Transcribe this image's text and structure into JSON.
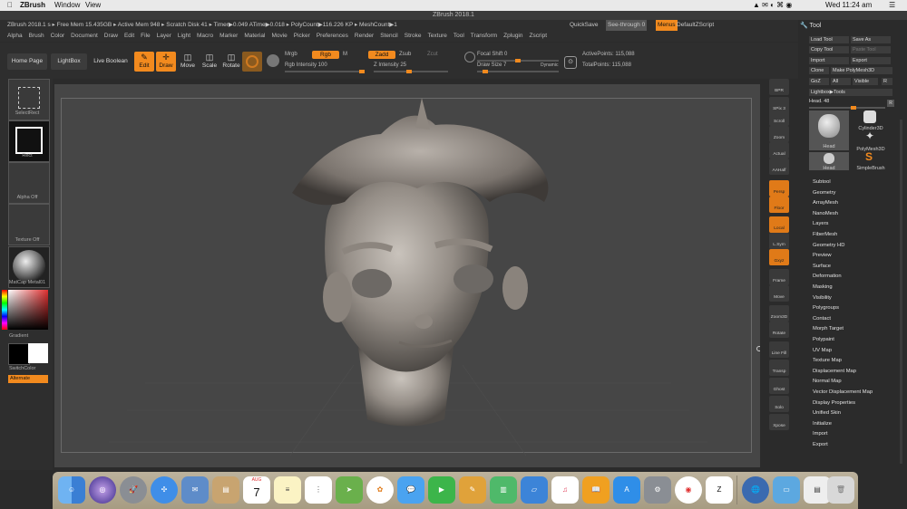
{
  "mac_menubar": {
    "app": "ZBrush",
    "menu_window": "Window",
    "menu_view": "View",
    "clock": "Wed 11:24 am"
  },
  "window_title": "ZBrush 2018.1",
  "infobar": {
    "text": "ZBrush 2018.1 s  ▸ Free Mem 15.435GB ▸ Active Mem 948 ▸ Scratch Disk 41 ▸ Timer▶0.049 ATime▶0.018 ▸ PolyCount▶116.226 KP ▸ MeshCount▶1",
    "quicksave": "QuickSave",
    "see_through": "See-through  0",
    "menus": "Menus",
    "default_zscript": "DefaultZScript"
  },
  "menus": [
    "Alpha",
    "Brush",
    "Color",
    "Document",
    "Draw",
    "Edit",
    "File",
    "Layer",
    "Light",
    "Macro",
    "Marker",
    "Material",
    "Movie",
    "Picker",
    "Preferences",
    "Render",
    "Stencil",
    "Stroke",
    "Texture",
    "Tool",
    "Transform",
    "Zplugin",
    "Zscript"
  ],
  "toolbar": {
    "home_page": "Home Page",
    "lightbox": "LightBox",
    "live_boolean": "Live Boolean",
    "edit": "Edit",
    "draw": "Draw",
    "move": "Move",
    "scale": "Scale",
    "rotate": "Rotate",
    "mrgb": "Mrgb",
    "rgb": "Rgb",
    "m": "M",
    "rgb_intensity": "Rgb Intensity 100",
    "zadd": "Zadd",
    "zsub": "Zsub",
    "zcut": "Zcut",
    "z_intensity": "Z Intensity 25",
    "focal_shift": "Focal Shift 0",
    "draw_size": "Draw Size 7",
    "dynamic": "Dynamic",
    "active_points": "ActivePoints: 115,088",
    "total_points": "TotalPoints: 115,088"
  },
  "left_panel": {
    "select_rect": "SelectRect",
    "rect": "Rect",
    "alpha_off": "Alpha Off",
    "texture_off": "Texture Off",
    "matcap": "MatCap Metal01",
    "gradient": "Gradient",
    "switch_color": "SwitchColor",
    "alternate": "Alternate"
  },
  "right_shelf": [
    "BPR",
    "SPix 3",
    "Scroll",
    "Zoom",
    "Actual",
    "AAHalf",
    "Persp",
    "Floor",
    "Local",
    "L.Sym",
    "Gxyz",
    "Frame",
    "Move",
    "Zoom3D",
    "Rotate",
    "Line Fill PolyF",
    "Transp",
    "Ghost",
    "Solo",
    "Xpose"
  ],
  "tool_panel": {
    "title": "Tool",
    "load_tool": "Load Tool",
    "save_as": "Save As",
    "copy_tool": "Copy Tool",
    "paste_tool": "Paste Tool",
    "import": "Import",
    "export": "Export",
    "clone": "Clone",
    "make_polymesh": "Make PolyMesh3D",
    "goz": "GoZ",
    "all": "All",
    "visible": "Visible",
    "r": "R",
    "lightbox_tools": "Lightbox▶Tools",
    "head_slider": "Head. 48",
    "thumb_head": "Head",
    "thumb_cylinder": "Cylinder3D",
    "thumb_polymesh": "PolyMesh3D",
    "thumb_head2": "Head",
    "thumb_simplebrush": "SimpleBrush",
    "subpalettes": [
      "Subtool",
      "Geometry",
      "ArrayMesh",
      "NanoMesh",
      "Layers",
      "FiberMesh",
      "Geometry HD",
      "Preview",
      "Surface",
      "Deformation",
      "Masking",
      "Visibility",
      "Polygroups",
      "Contact",
      "Morph Target",
      "Polypaint",
      "UV Map",
      "Texture Map",
      "Displacement Map",
      "Normal Map",
      "Vector Displacement Map",
      "Display Properties",
      "Unified Skin",
      "Initialize",
      "Import",
      "Export"
    ]
  },
  "dock": {
    "calendar_month": "AUG",
    "calendar_day": "7"
  },
  "colors": {
    "accent": "#f28a1e",
    "panel": "#2e2e2e",
    "viewport": "#464646"
  }
}
